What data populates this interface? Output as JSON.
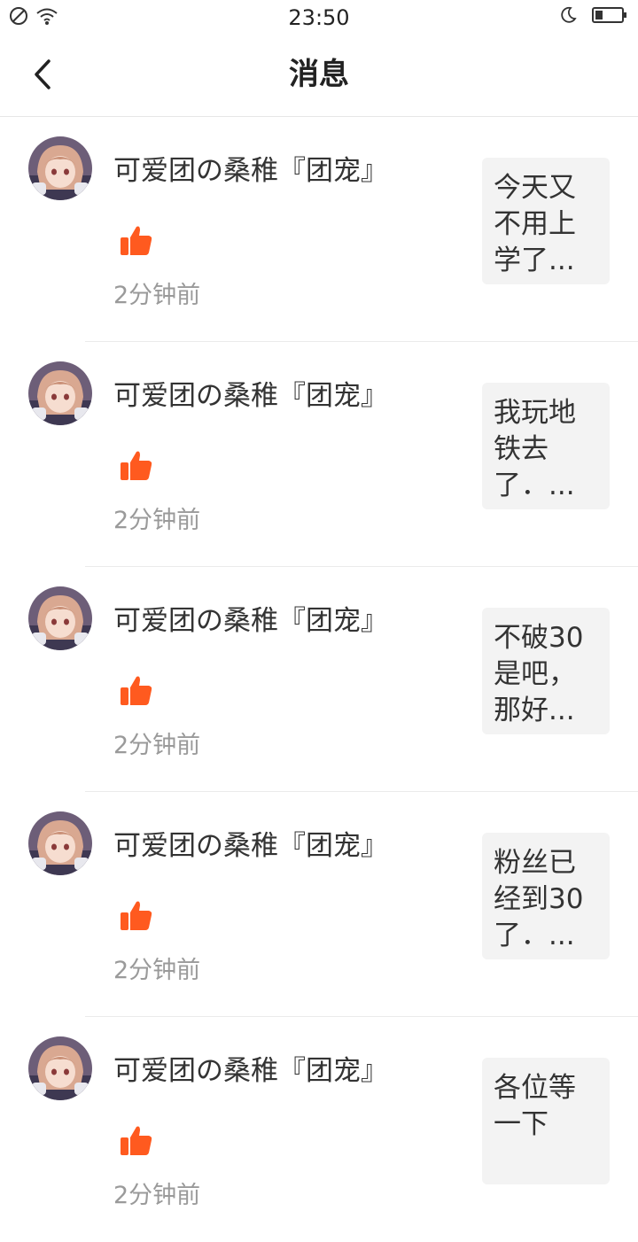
{
  "status_bar": {
    "time": "23:50"
  },
  "header": {
    "title": "消息"
  },
  "messages": [
    {
      "username": "可爱团の桑稚『团宠』",
      "time_ago": "2分钟前",
      "preview": "今天又不用上学了..."
    },
    {
      "username": "可爱团の桑稚『团宠』",
      "time_ago": "2分钟前",
      "preview": "我玩地铁去了．..."
    },
    {
      "username": "可爱团の桑稚『团宠』",
      "time_ago": "2分钟前",
      "preview": "不破30是吧，那好..."
    },
    {
      "username": "可爱团の桑稚『团宠』",
      "time_ago": "2分钟前",
      "preview": "粉丝已经到30了．..."
    },
    {
      "username": "可爱团の桑稚『团宠』",
      "time_ago": "2分钟前",
      "preview": "各位等一下"
    }
  ],
  "colors": {
    "like_icon": "#ff5a1f",
    "divider": "#ebebeb",
    "preview_bg": "#f3f3f3",
    "secondary_text": "#9a9a9a"
  },
  "icons": {
    "back": "chevron-left-icon",
    "like": "thumbs-up-icon",
    "status_left": [
      "no-sim-icon",
      "wifi-icon"
    ],
    "status_right": [
      "moon-icon",
      "battery-icon"
    ]
  }
}
